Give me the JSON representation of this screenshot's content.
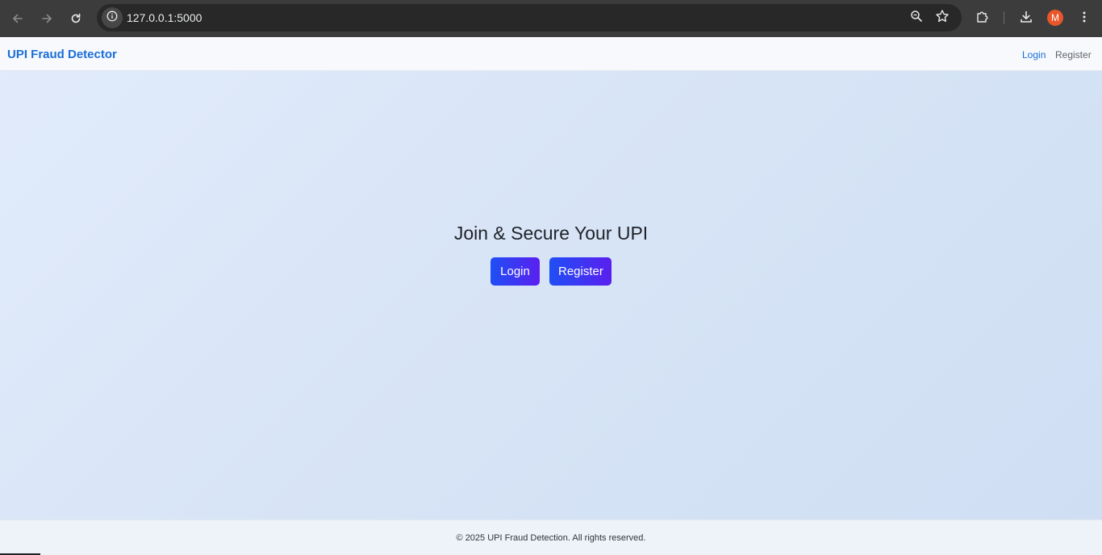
{
  "browser": {
    "url": "127.0.0.1:5000",
    "profile_initial": "M",
    "profile_color": "#e8562a",
    "icons": {
      "back": "arrow-left-icon",
      "forward": "arrow-right-icon",
      "reload": "reload-icon",
      "site_info": "info-icon",
      "zoom": "zoom-icon",
      "bookmark": "star-icon",
      "extensions": "puzzle-icon",
      "downloads": "download-icon",
      "menu": "kebab-menu-icon"
    }
  },
  "navbar": {
    "brand": "UPI Fraud Detector",
    "links": {
      "login": "Login",
      "register": "Register"
    },
    "accent_color": "#1a6ed8"
  },
  "hero": {
    "title": "Join & Secure Your UPI",
    "login_button": "Login",
    "register_button": "Register"
  },
  "footer": {
    "text": "© 2025 UPI Fraud Detection. All rights reserved."
  }
}
